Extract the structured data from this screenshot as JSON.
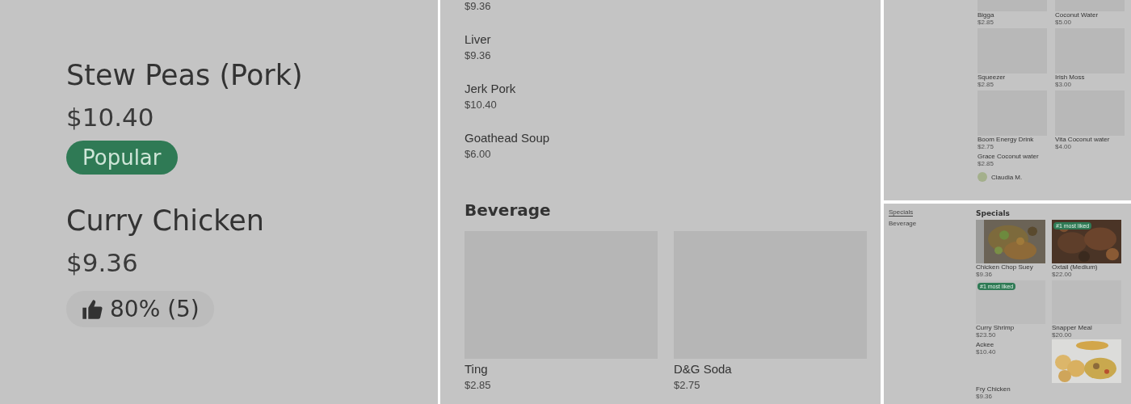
{
  "panel_detail": {
    "items": [
      {
        "name": "Stew Peas (Pork)",
        "price": "$10.40",
        "badge": "Popular"
      },
      {
        "name": "Curry Chicken",
        "price": "$9.36",
        "rating": "80% (5)"
      }
    ]
  },
  "panel_list": {
    "top_price": "$9.36",
    "items": [
      {
        "name": "Liver",
        "price": "$9.36"
      },
      {
        "name": "Jerk Pork",
        "price": "$10.40"
      },
      {
        "name": "Goathead Soup",
        "price": "$6.00"
      }
    ],
    "section_title": "Beverage",
    "cards": [
      {
        "name": "Ting",
        "price": "$2.85"
      },
      {
        "name": "D&G Soda",
        "price": "$2.75"
      }
    ]
  },
  "panel_beverages": {
    "cards": [
      {
        "kind": "placeholder",
        "name": "Bigga",
        "price": "$2.85"
      },
      {
        "kind": "placeholder",
        "name": "Coconut Water",
        "price": "$5.00"
      },
      {
        "kind": "placeholder",
        "name": "Squeezer",
        "price": "$2.85"
      },
      {
        "kind": "placeholder",
        "name": "Irish Moss",
        "price": "$3.00"
      },
      {
        "kind": "placeholder",
        "name": "Boom Energy Drink",
        "price": "$2.75"
      },
      {
        "kind": "placeholder",
        "name": "Vita Coconut water",
        "price": "$4.00"
      },
      {
        "kind": "text",
        "name": "Grace Coconut water",
        "price": "$2.85"
      }
    ],
    "reviewer": "Claudia M."
  },
  "panel_specials": {
    "sidebar": [
      {
        "label": "Specials",
        "selected": true
      },
      {
        "label": "Beverage",
        "selected": false
      }
    ],
    "title": "Specials",
    "cards": [
      {
        "name": "Chicken Chop Suey",
        "price": "$9.36"
      },
      {
        "name": "Oxtail (Medium)",
        "price": "$22.00",
        "badge": "#1 most liked"
      },
      {
        "kind": "placeholder",
        "name": "Curry Shrimp",
        "price": "$23.50",
        "badge": "#1 most liked"
      },
      {
        "kind": "placeholder",
        "name": "Snapper Meal",
        "price": "$20.00"
      },
      {
        "kind": "text",
        "name": "Ackee",
        "price": "$10.40"
      },
      {
        "kind": "picture"
      },
      {
        "kind": "text",
        "name": "Fry Chicken",
        "price": "$9.36"
      }
    ]
  }
}
